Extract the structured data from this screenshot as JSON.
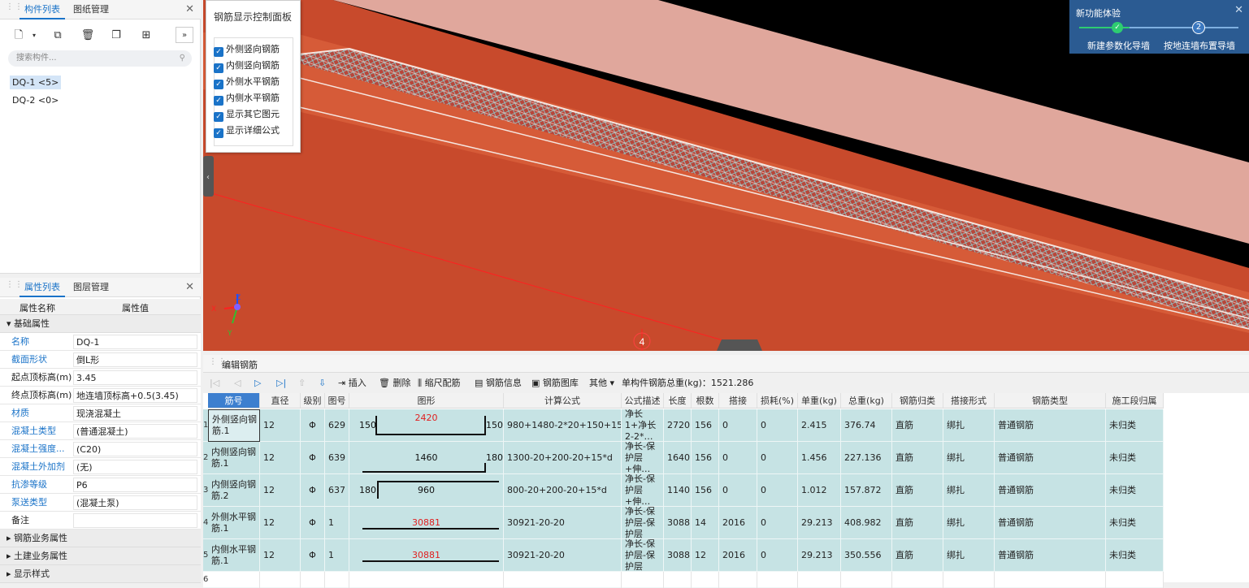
{
  "left_top": {
    "tabs": [
      "构件列表",
      "图纸管理"
    ],
    "search_placeholder": "搜索构件...",
    "components": [
      "DQ-1 <5>",
      "DQ-2 <0>"
    ]
  },
  "props": {
    "tabs": [
      "属性列表",
      "图层管理"
    ],
    "header": {
      "name": "属性名称",
      "value": "属性值"
    },
    "group_basic": "基础属性",
    "rows": [
      {
        "name": "名称",
        "value": "DQ-1",
        "blue": true
      },
      {
        "name": "截面形状",
        "value": "倒L形",
        "blue": true
      },
      {
        "name": "起点顶标高(m)",
        "value": "3.45",
        "blue": false
      },
      {
        "name": "终点顶标高(m)",
        "value": "地连墙顶标高+0.5(3.45)",
        "blue": false
      },
      {
        "name": "材质",
        "value": "现浇混凝土",
        "blue": true
      },
      {
        "name": "混凝土类型",
        "value": "(普通混凝土)",
        "blue": true
      },
      {
        "name": "混凝土强度...",
        "value": "(C20)",
        "blue": true
      },
      {
        "name": "混凝土外加剂",
        "value": "(无)",
        "blue": true
      },
      {
        "name": "抗渗等级",
        "value": "P6",
        "blue": true
      },
      {
        "name": "泵送类型",
        "value": "(混凝土泵)",
        "blue": true
      },
      {
        "name": "备注",
        "value": "",
        "blue": false
      }
    ],
    "groups": [
      "钢筋业务属性",
      "土建业务属性",
      "显示样式"
    ]
  },
  "control_panel": {
    "title": "钢筋显示控制面板",
    "items": [
      "外侧竖向钢筋",
      "内侧竖向钢筋",
      "外侧水平钢筋",
      "内侧水平钢筋",
      "显示其它图元",
      "显示详细公式"
    ]
  },
  "new_feature": {
    "title": "新功能体验",
    "step1": "新建参数化导墙",
    "step2": "按地连墙布置导墙",
    "step2_num": "2"
  },
  "viewport": {
    "axis_label": "4",
    "x": "X",
    "y": "Y",
    "z": "Z"
  },
  "rebar_editor": {
    "title": "编辑钢筋",
    "tools": {
      "insert": "插入",
      "delete": "删除",
      "scale": "缩尺配筋",
      "info": "钢筋信息",
      "library": "钢筋图库",
      "other": "其他"
    },
    "total_weight": "单构件钢筋总重(kg)：1521.286",
    "columns": [
      "筋号",
      "直径(mm)",
      "级别",
      "图号",
      "图形",
      "计算公式",
      "公式描述",
      "长度",
      "根数",
      "搭接",
      "损耗(%)",
      "单重(kg)",
      "总重(kg)",
      "钢筋归类",
      "搭接形式",
      "钢筋类型",
      "施工段归属"
    ],
    "rows": [
      {
        "num": "1",
        "name": "外侧竖向钢筋.1",
        "dia": "12",
        "grade": "Φ",
        "fig": "629",
        "shape_left": "150",
        "shape_mid": "2420",
        "shape_right": "150",
        "formula": "980+1480-2*20+150+150",
        "desc": "净长1+净长2-2*…",
        "len": "2720",
        "count": "156",
        "lap": "0",
        "loss": "0",
        "unit": "2.415",
        "total": "376.74",
        "cat": "直筋",
        "laptype": "绑扎",
        "type": "普通钢筋",
        "seg": "未归类"
      },
      {
        "num": "2",
        "name": "内侧竖向钢筋.1",
        "dia": "12",
        "grade": "Φ",
        "fig": "639",
        "shape_left": "",
        "shape_mid": "1460",
        "shape_right": "180",
        "formula": "1300-20+200-20+15*d",
        "desc": "净长-保护层+伸…",
        "len": "1640",
        "count": "156",
        "lap": "0",
        "loss": "0",
        "unit": "1.456",
        "total": "227.136",
        "cat": "直筋",
        "laptype": "绑扎",
        "type": "普通钢筋",
        "seg": "未归类"
      },
      {
        "num": "3",
        "name": "内侧竖向钢筋.2",
        "dia": "12",
        "grade": "Φ",
        "fig": "637",
        "shape_left": "180",
        "shape_mid": "960",
        "shape_right": "",
        "formula": "800-20+200-20+15*d",
        "desc": "净长-保护层+伸…",
        "len": "1140",
        "count": "156",
        "lap": "0",
        "loss": "0",
        "unit": "1.012",
        "total": "157.872",
        "cat": "直筋",
        "laptype": "绑扎",
        "type": "普通钢筋",
        "seg": "未归类"
      },
      {
        "num": "4",
        "name": "外侧水平钢筋.1",
        "dia": "12",
        "grade": "Φ",
        "fig": "1",
        "shape_left": "",
        "shape_mid": "30881",
        "shape_right": "",
        "formula": "30921-20-20",
        "desc": "净长-保护层-保护层",
        "len": "30881",
        "count": "14",
        "lap": "2016",
        "loss": "0",
        "unit": "29.213",
        "total": "408.982",
        "cat": "直筋",
        "laptype": "绑扎",
        "type": "普通钢筋",
        "seg": "未归类"
      },
      {
        "num": "5",
        "name": "内侧水平钢筋.1",
        "dia": "12",
        "grade": "Φ",
        "fig": "1",
        "shape_left": "",
        "shape_mid": "30881",
        "shape_right": "",
        "formula": "30921-20-20",
        "desc": "净长-保护层-保护层",
        "len": "30881",
        "count": "12",
        "lap": "2016",
        "loss": "0",
        "unit": "29.213",
        "total": "350.556",
        "cat": "直筋",
        "laptype": "绑扎",
        "type": "普通钢筋",
        "seg": "未归类"
      }
    ],
    "empty_row_num": "6"
  },
  "colors": {
    "accent": "#1a73c8",
    "grid_row": "#c6e3e4",
    "wall": "#c8452a",
    "wall_top": "#dfa096",
    "feature_bg": "#2b5b92"
  }
}
